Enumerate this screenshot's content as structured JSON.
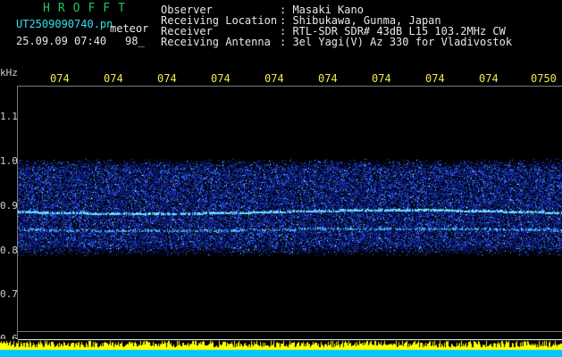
{
  "header": {
    "logo": "HROFFT",
    "filename": "UT2509090740.pn",
    "meteor_label": "meteor",
    "datetime": "25.09.09 07:40",
    "count": "98_",
    "info_labels": [
      "Observer",
      "Receiving Location",
      "Receiver",
      "Receiving Antenna"
    ],
    "info_values": [
      ": Masaki Kano",
      ": Shibukawa, Gunma, Japan",
      ": RTL-SDR SDR# 43dB L15 103.2MHz CW",
      ": 3el Yagi(V) Az 330 for Vladivostok"
    ]
  },
  "axis": {
    "unit": "kHz",
    "labels": [
      "1.1",
      "1.0",
      "0.9",
      "0.8",
      "0.7",
      "0.6"
    ]
  },
  "time_ticks": [
    "074",
    "074",
    "074",
    "074",
    "074",
    "074",
    "074",
    "074",
    "074",
    "0750"
  ],
  "colors": {
    "background": "#000000",
    "label_white": "#e8e8e8",
    "value_cyan": "#33e0ee",
    "logo_green": "#22c55e",
    "tick_yellow": "#f2e84a",
    "signal_blue": "#2a52ff",
    "band_cyan": "#00c8ff",
    "band_yellow": "#ffff00"
  }
}
